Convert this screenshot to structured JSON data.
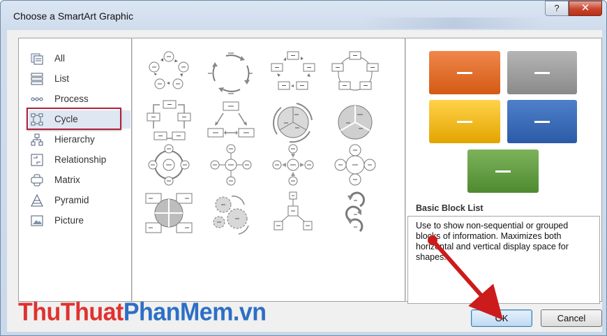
{
  "window": {
    "title": "Choose a SmartArt Graphic",
    "help_glyph": "?",
    "close_glyph": "✕"
  },
  "categories": [
    {
      "label": "All",
      "icon": "all-icon"
    },
    {
      "label": "List",
      "icon": "list-icon"
    },
    {
      "label": "Process",
      "icon": "process-icon"
    },
    {
      "label": "Cycle",
      "icon": "cycle-icon",
      "selected": true
    },
    {
      "label": "Hierarchy",
      "icon": "hierarchy-icon"
    },
    {
      "label": "Relationship",
      "icon": "relationship-icon"
    },
    {
      "label": "Matrix",
      "icon": "matrix-icon"
    },
    {
      "label": "Pyramid",
      "icon": "pyramid-icon"
    },
    {
      "label": "Picture",
      "icon": "picture-icon"
    }
  ],
  "gallery": {
    "layouts": [
      "basic-cycle-icon",
      "text-cycle-icon",
      "block-cycle-icon",
      "nondirectional-cycle-icon",
      "continuous-cycle-icon",
      "multidirectional-cycle-icon",
      "segmented-cycle-icon",
      "basic-pie-icon",
      "radial-cycle-icon",
      "basic-radial-icon",
      "diverging-radial-icon",
      "radial-venn-icon",
      "cycle-matrix-icon",
      "gear-icon",
      "radial-cluster-icon",
      "circle-arrow-process-icon"
    ]
  },
  "preview": {
    "colors": {
      "orange": "#E36C23",
      "gray": "#999999",
      "yellow": "#F2B705",
      "blue": "#3A6DB8",
      "green": "#5E9C3E"
    },
    "block_text": "—",
    "layout_name": "Basic Block List",
    "description": "Use to show non-sequential or grouped blocks of information. Maximizes both horizontal and vertical display space for shapes."
  },
  "buttons": {
    "ok": "OK",
    "cancel": "Cancel"
  },
  "watermark": {
    "part1": "ThuThuat",
    "part2": "PhanMem.vn"
  }
}
